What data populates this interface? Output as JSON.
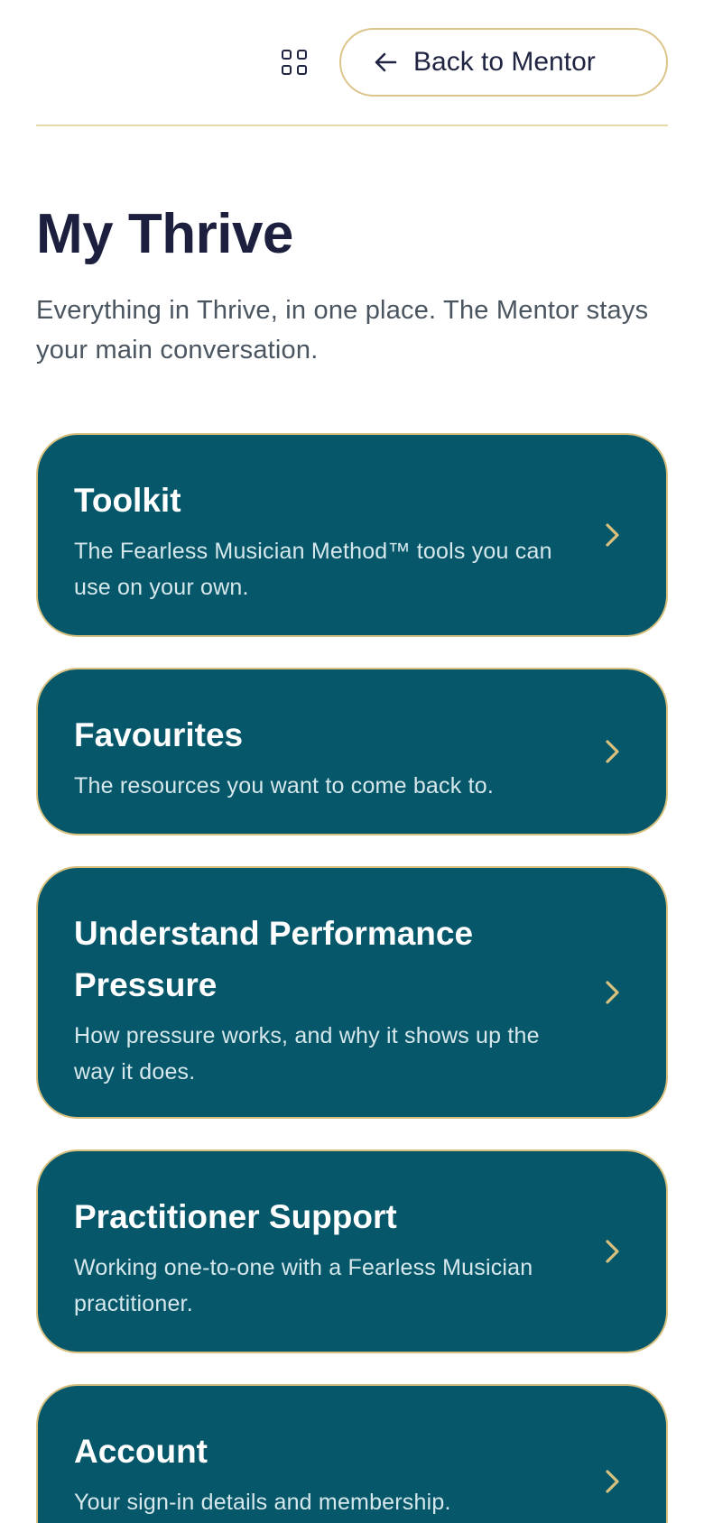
{
  "header": {
    "back_label": "Back to Mentor"
  },
  "page": {
    "title": "My Thrive",
    "subtitle": "Everything in Thrive, in one place. The Mentor stays your main conversation."
  },
  "cards": [
    {
      "title": "Toolkit",
      "description": "The Fearless Musician Method™ tools you can use on your own."
    },
    {
      "title": "Favourites",
      "description": "The resources you want to come back to."
    },
    {
      "title": "Understand Performance Pressure",
      "description": "How pressure works, and why it shows up the way it does."
    },
    {
      "title": "Practitioner Support",
      "description": "Working one-to-one with a Fearless Musician practitioner."
    },
    {
      "title": "Account",
      "description": "Your sign-in details and membership."
    }
  ],
  "icons": {
    "menu": "grid-icon",
    "back": "arrow-left-icon",
    "card_chevron": "chevron-right-icon"
  },
  "colors": {
    "card_background": "#06576a",
    "accent_gold": "#d8c07e",
    "title_navy": "#1c1f3d"
  }
}
